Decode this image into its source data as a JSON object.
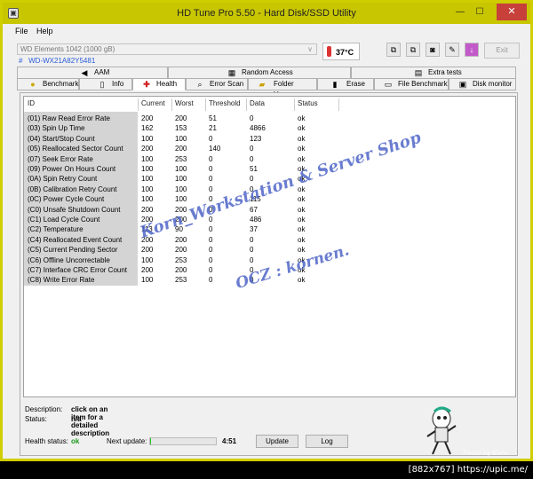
{
  "window": {
    "title": "HD Tune Pro 5.50 - Hard Disk/SSD Utility",
    "close_glyph": "✕",
    "minimize_glyph": "—",
    "maximize_glyph": "☐"
  },
  "menu": [
    {
      "label": "File"
    },
    {
      "label": "Help"
    }
  ],
  "drive": {
    "selected": "WD        Elements 1042 (1000 gB)",
    "serial_prefix": "#",
    "serial": "WD-WX21A82Y5481",
    "temperature": "37",
    "temperature_unit": "°C",
    "exit_label": "Exit"
  },
  "tabs_top": [
    {
      "label": "AAM",
      "icon": "speaker-icon"
    },
    {
      "label": "Random Access",
      "icon": "grid-icon"
    },
    {
      "label": "Extra tests",
      "icon": "extra-tests-icon"
    }
  ],
  "tabs_bottom": [
    {
      "label": "Benchmark",
      "icon": "bulb-icon"
    },
    {
      "label": "Info",
      "icon": "info-icon"
    },
    {
      "label": "Health",
      "icon": "health-cross-icon"
    },
    {
      "label": "Error Scan",
      "icon": "magnifier-icon"
    },
    {
      "label": "Folder Usage",
      "icon": "folder-icon"
    },
    {
      "label": "Erase",
      "icon": "trash-icon"
    },
    {
      "label": "File Benchmark",
      "icon": "file-icon"
    },
    {
      "label": "Disk monitor",
      "icon": "monitor-icon"
    }
  ],
  "active_tab": "Health",
  "table": {
    "columns": [
      "ID",
      "Current",
      "Worst",
      "Threshold",
      "Data",
      "Status"
    ],
    "rows": [
      [
        "(01) Raw Read Error Rate",
        "200",
        "200",
        "51",
        "0",
        "ok"
      ],
      [
        "(03) Spin Up Time",
        "162",
        "153",
        "21",
        "4866",
        "ok"
      ],
      [
        "(04) Start/Stop Count",
        "100",
        "100",
        "0",
        "123",
        "ok"
      ],
      [
        "(05) Reallocated Sector Count",
        "200",
        "200",
        "140",
        "0",
        "ok"
      ],
      [
        "(07) Seek Error Rate",
        "100",
        "253",
        "0",
        "0",
        "ok"
      ],
      [
        "(09) Power On Hours Count",
        "100",
        "100",
        "0",
        "51",
        "ok"
      ],
      [
        "(0A) Spin Retry Count",
        "100",
        "100",
        "0",
        "0",
        "ok"
      ],
      [
        "(0B) Calibration Retry Count",
        "100",
        "100",
        "0",
        "0",
        "ok"
      ],
      [
        "(0C) Power Cycle Count",
        "100",
        "100",
        "0",
        "115",
        "ok"
      ],
      [
        "(C0) Unsafe Shutdown Count",
        "200",
        "200",
        "0",
        "67",
        "ok"
      ],
      [
        "(C1) Load Cycle Count",
        "200",
        "200",
        "0",
        "486",
        "ok"
      ],
      [
        "(C2) Temperature",
        "113",
        "90",
        "0",
        "37",
        "ok"
      ],
      [
        "(C4) Reallocated Event Count",
        "200",
        "200",
        "0",
        "0",
        "ok"
      ],
      [
        "(C5) Current Pending Sector",
        "200",
        "200",
        "0",
        "0",
        "ok"
      ],
      [
        "(C6) Offline Uncorrectable",
        "100",
        "253",
        "0",
        "0",
        "ok"
      ],
      [
        "(C7) Interface CRC Error Count",
        "200",
        "200",
        "0",
        "0",
        "ok"
      ],
      [
        "(C8) Write Error Rate",
        "100",
        "253",
        "0",
        "0",
        "ok"
      ]
    ]
  },
  "watermarks": [
    "Korn_Workstation & Server Shop",
    "OCZ : kornen."
  ],
  "description": {
    "label": "Description:",
    "text": "click on an item for a detailed description"
  },
  "status": {
    "label": "Status:",
    "value": "n/a"
  },
  "health": {
    "label": "Health status:",
    "value": "ok",
    "value_color": "#1a9a1a"
  },
  "next_update": {
    "label": "Next update:",
    "time": "4:51",
    "progress": 0.02
  },
  "buttons": {
    "update": "Update",
    "log": "Log"
  },
  "photo_credit": "Photo by Korn",
  "footer": "[882x767] https://upic.me/"
}
